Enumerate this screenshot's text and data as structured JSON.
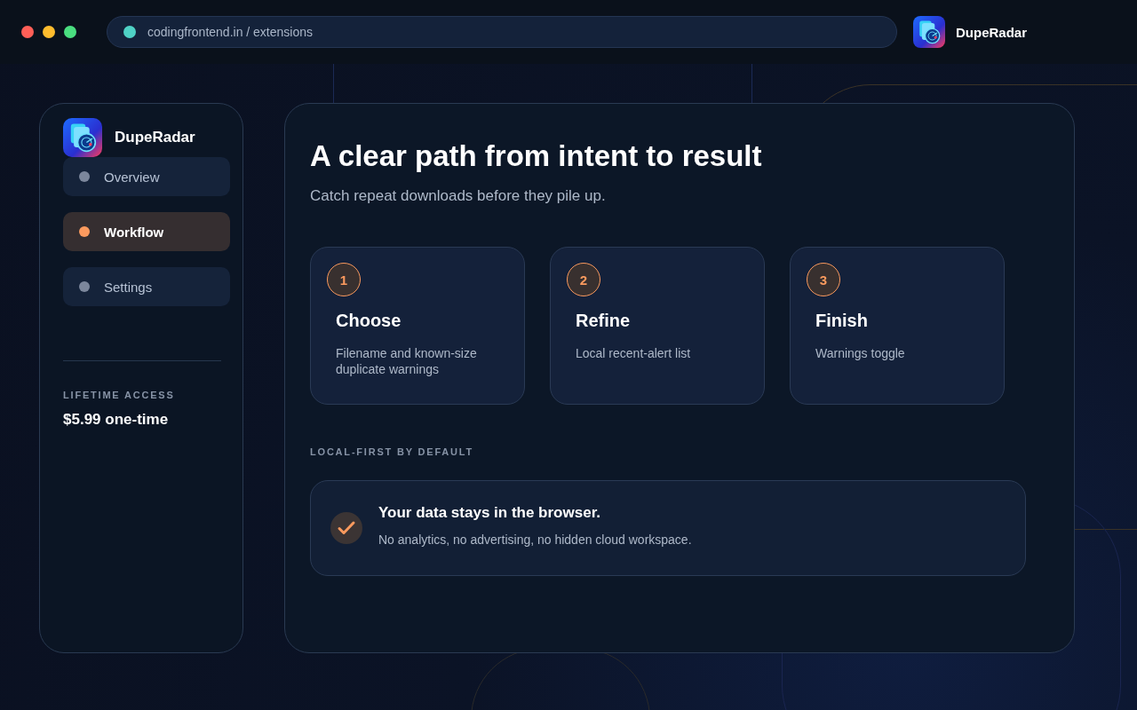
{
  "address_bar": {
    "url": "codingfrontend.in / extensions"
  },
  "app_badge": {
    "name": "DupeRadar"
  },
  "sidebar": {
    "brand": "DupeRadar",
    "items": [
      {
        "label": "Overview",
        "selected": false
      },
      {
        "label": "Workflow",
        "selected": true
      },
      {
        "label": "Settings",
        "selected": false
      }
    ],
    "plan_label": "LIFETIME ACCESS",
    "plan_price": "$5.99 one-time"
  },
  "main": {
    "title": "A clear path from intent to result",
    "subtitle": "Catch repeat downloads before they pile up.",
    "steps": [
      {
        "number": "1",
        "title": "Choose",
        "text": "Filename and known-size duplicate warnings"
      },
      {
        "number": "2",
        "title": "Refine",
        "text": "Local recent-alert list"
      },
      {
        "number": "3",
        "title": "Finish",
        "text": "Warnings toggle"
      }
    ],
    "section_label": "LOCAL-FIRST BY DEFAULT",
    "notice": {
      "checked": true,
      "title": "Your data stays in the browser.",
      "text": "No analytics, no advertising, no hidden cloud workspace."
    }
  }
}
